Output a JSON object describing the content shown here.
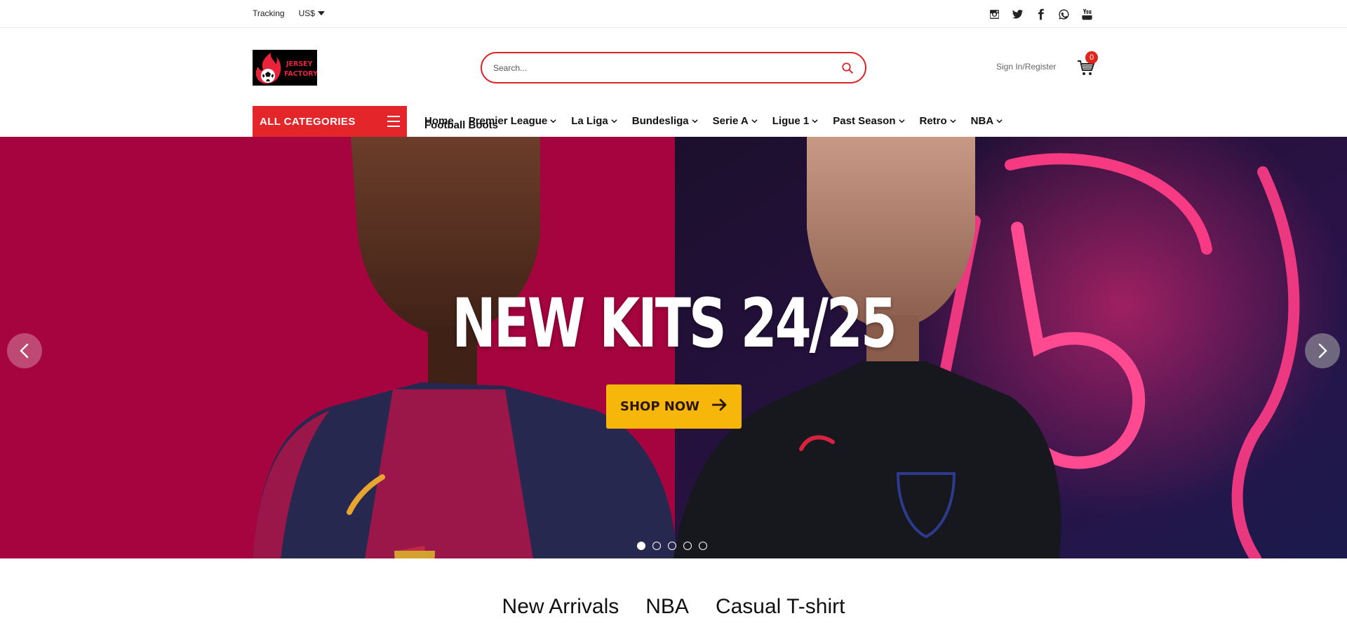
{
  "topbar": {
    "tracking": "Tracking",
    "currency": "US$",
    "social": [
      "instagram-icon",
      "twitter-icon",
      "facebook-icon",
      "whatsapp-icon",
      "youtube-icon"
    ]
  },
  "header": {
    "logo_text": [
      "JERSEY",
      "FACTORY"
    ],
    "search_placeholder": "Search...",
    "signin": "Sign In/Register",
    "cart_count": "0"
  },
  "nav": {
    "all_categories": "ALL CATEGORIES",
    "items": [
      "Home",
      "Premier League",
      "La Liga",
      "Bundesliga",
      "Serie A",
      "Ligue 1",
      "Past Season",
      "Retro",
      "NBA"
    ],
    "has_dropdown": [
      false,
      true,
      true,
      true,
      true,
      true,
      true,
      true,
      true
    ],
    "second_row": "Football Boots"
  },
  "hero": {
    "title": "NEW KITS 24/25",
    "button": "SHOP NOW",
    "slides": 5,
    "active_slide": 1
  },
  "product_tabs": [
    "New Arrivals",
    "NBA",
    "Casual T-shirt"
  ],
  "colors": {
    "accent_red": "#e4262a",
    "hero_bg": "#a5043e",
    "button_yellow": "#f6b70a"
  }
}
